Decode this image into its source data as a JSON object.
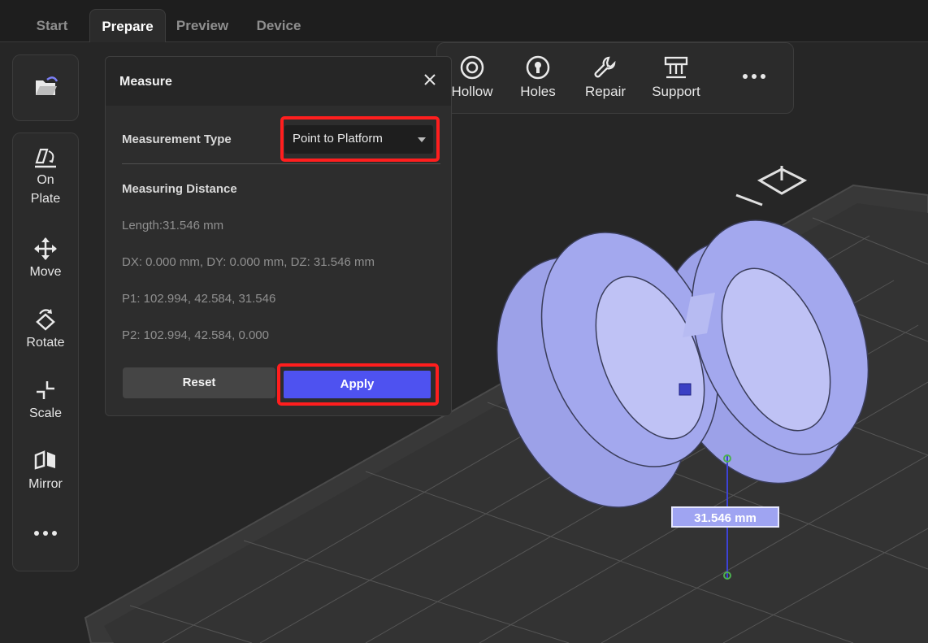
{
  "tabs": [
    {
      "label": "Start",
      "active": false
    },
    {
      "label": "Prepare",
      "active": true
    },
    {
      "label": "Preview",
      "active": false
    },
    {
      "label": "Device",
      "active": false
    }
  ],
  "left_toolbar": {
    "tools": [
      {
        "label": "On\nPlate",
        "icon": "on-plate-icon"
      },
      {
        "label": "Move",
        "icon": "move-icon"
      },
      {
        "label": "Rotate",
        "icon": "rotate-icon"
      },
      {
        "label": "Scale",
        "icon": "scale-icon"
      },
      {
        "label": "Mirror",
        "icon": "mirror-icon"
      },
      {
        "label": "",
        "icon": "more-icon"
      }
    ],
    "open_icon": "folder-open-icon"
  },
  "top_toolbar": {
    "tools": [
      {
        "label": "Hollow",
        "icon": "hollow-icon"
      },
      {
        "label": "Holes",
        "icon": "holes-icon"
      },
      {
        "label": "Repair",
        "icon": "wrench-icon"
      },
      {
        "label": "Support",
        "icon": "support-icon"
      },
      {
        "label": "",
        "icon": "more-icon"
      }
    ]
  },
  "measure_dialog": {
    "title": "Measure",
    "type_label": "Measurement Type",
    "type_value": "Point to Platform",
    "distance_heading": "Measuring Distance",
    "length": "Length:31.546 mm",
    "deltas": "DX: 0.000 mm, DY: 0.000 mm, DZ: 31.546 mm",
    "p1": "P1: 102.994, 42.584, 31.546",
    "p2": "P2: 102.994, 42.584, 0.000",
    "reset_label": "Reset",
    "apply_label": "Apply"
  },
  "viewport": {
    "measurement_label": "31.546 mm",
    "model_color": "#a3a8ee",
    "highlight_color": "#ff1e1e",
    "accent_color": "#4e52f0"
  }
}
